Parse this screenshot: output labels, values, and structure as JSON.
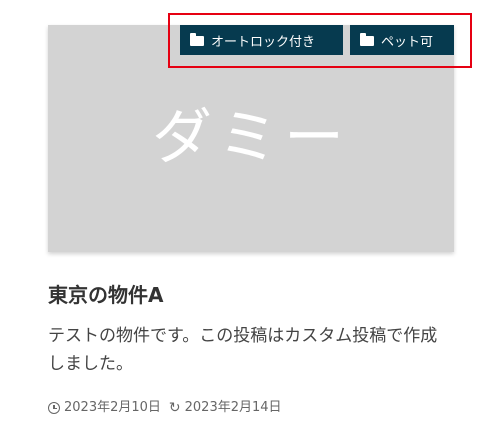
{
  "thumbnail": {
    "text": "ダミー"
  },
  "tags": [
    {
      "label": "オートロック付き",
      "icon": "folder-icon"
    },
    {
      "label": "ペット可",
      "icon": "folder-icon"
    }
  ],
  "post": {
    "title": "東京の物件A",
    "excerpt": "テストの物件です。この投稿はカスタム投稿で作成しました。",
    "published_icon": "clock-icon",
    "published_date": "2023年2月10日",
    "updated_icon": "update-icon",
    "updated_date": "2023年2月14日"
  },
  "colors": {
    "tag_bg": "#063a4f",
    "highlight": "#e60012",
    "thumb_bg": "#d3d3d3"
  }
}
